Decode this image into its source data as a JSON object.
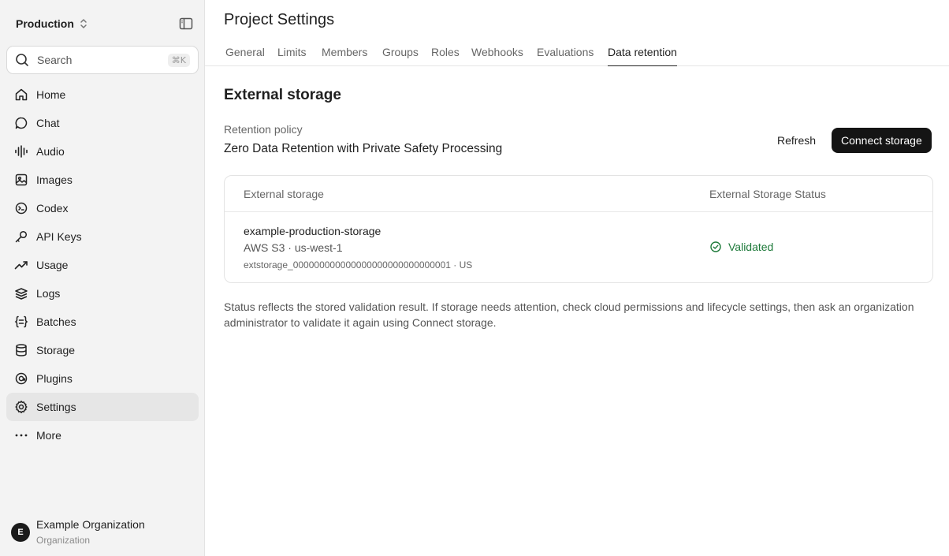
{
  "sidebar": {
    "project": "Production",
    "search": {
      "placeholder": "Search",
      "shortcut": "⌘K"
    },
    "items": [
      {
        "label": "Home",
        "icon": "home-icon"
      },
      {
        "label": "Chat",
        "icon": "chat-icon"
      },
      {
        "label": "Audio",
        "icon": "audio-icon"
      },
      {
        "label": "Images",
        "icon": "image-icon"
      },
      {
        "label": "Codex",
        "icon": "codex-icon"
      },
      {
        "label": "API Keys",
        "icon": "key-icon"
      },
      {
        "label": "Usage",
        "icon": "usage-icon"
      },
      {
        "label": "Logs",
        "icon": "logs-icon"
      },
      {
        "label": "Batches",
        "icon": "batches-icon"
      },
      {
        "label": "Storage",
        "icon": "storage-icon"
      },
      {
        "label": "Plugins",
        "icon": "plugins-icon"
      },
      {
        "label": "Settings",
        "icon": "settings-icon",
        "active": true
      },
      {
        "label": "More",
        "icon": "more-icon"
      }
    ],
    "org": {
      "initial": "E",
      "name": "Example Organization",
      "subtitle": "Organization"
    }
  },
  "header": {
    "title": "Project Settings",
    "tabs": [
      {
        "label": "General"
      },
      {
        "label": "Limits"
      },
      {
        "label": "Members"
      },
      {
        "label": "Groups"
      },
      {
        "label": "Roles"
      },
      {
        "label": "Webhooks"
      },
      {
        "label": "Evaluations"
      },
      {
        "label": "Data retention",
        "active": true
      }
    ]
  },
  "main": {
    "section_title": "External storage",
    "policy_label": "Retention policy",
    "policy_value": "Zero Data Retention with Private Safety Processing",
    "refresh_label": "Refresh",
    "connect_label": "Connect storage",
    "table": {
      "columns": [
        "External storage",
        "External Storage Status"
      ],
      "rows": [
        {
          "name": "example-production-storage",
          "provider": "AWS S3 · us-west-1",
          "id": "extstorage_000000000000000000000000000001 · US",
          "status": "Validated"
        }
      ]
    },
    "note": "Status reflects the stored validation result. If storage needs attention, check cloud permissions and lifecycle settings, then ask an organization administrator to validate it again using Connect storage."
  },
  "colors": {
    "status_ok": "#1e7a3a",
    "primary_button": "#141414",
    "sidebar_bg": "#f3f3f3"
  }
}
